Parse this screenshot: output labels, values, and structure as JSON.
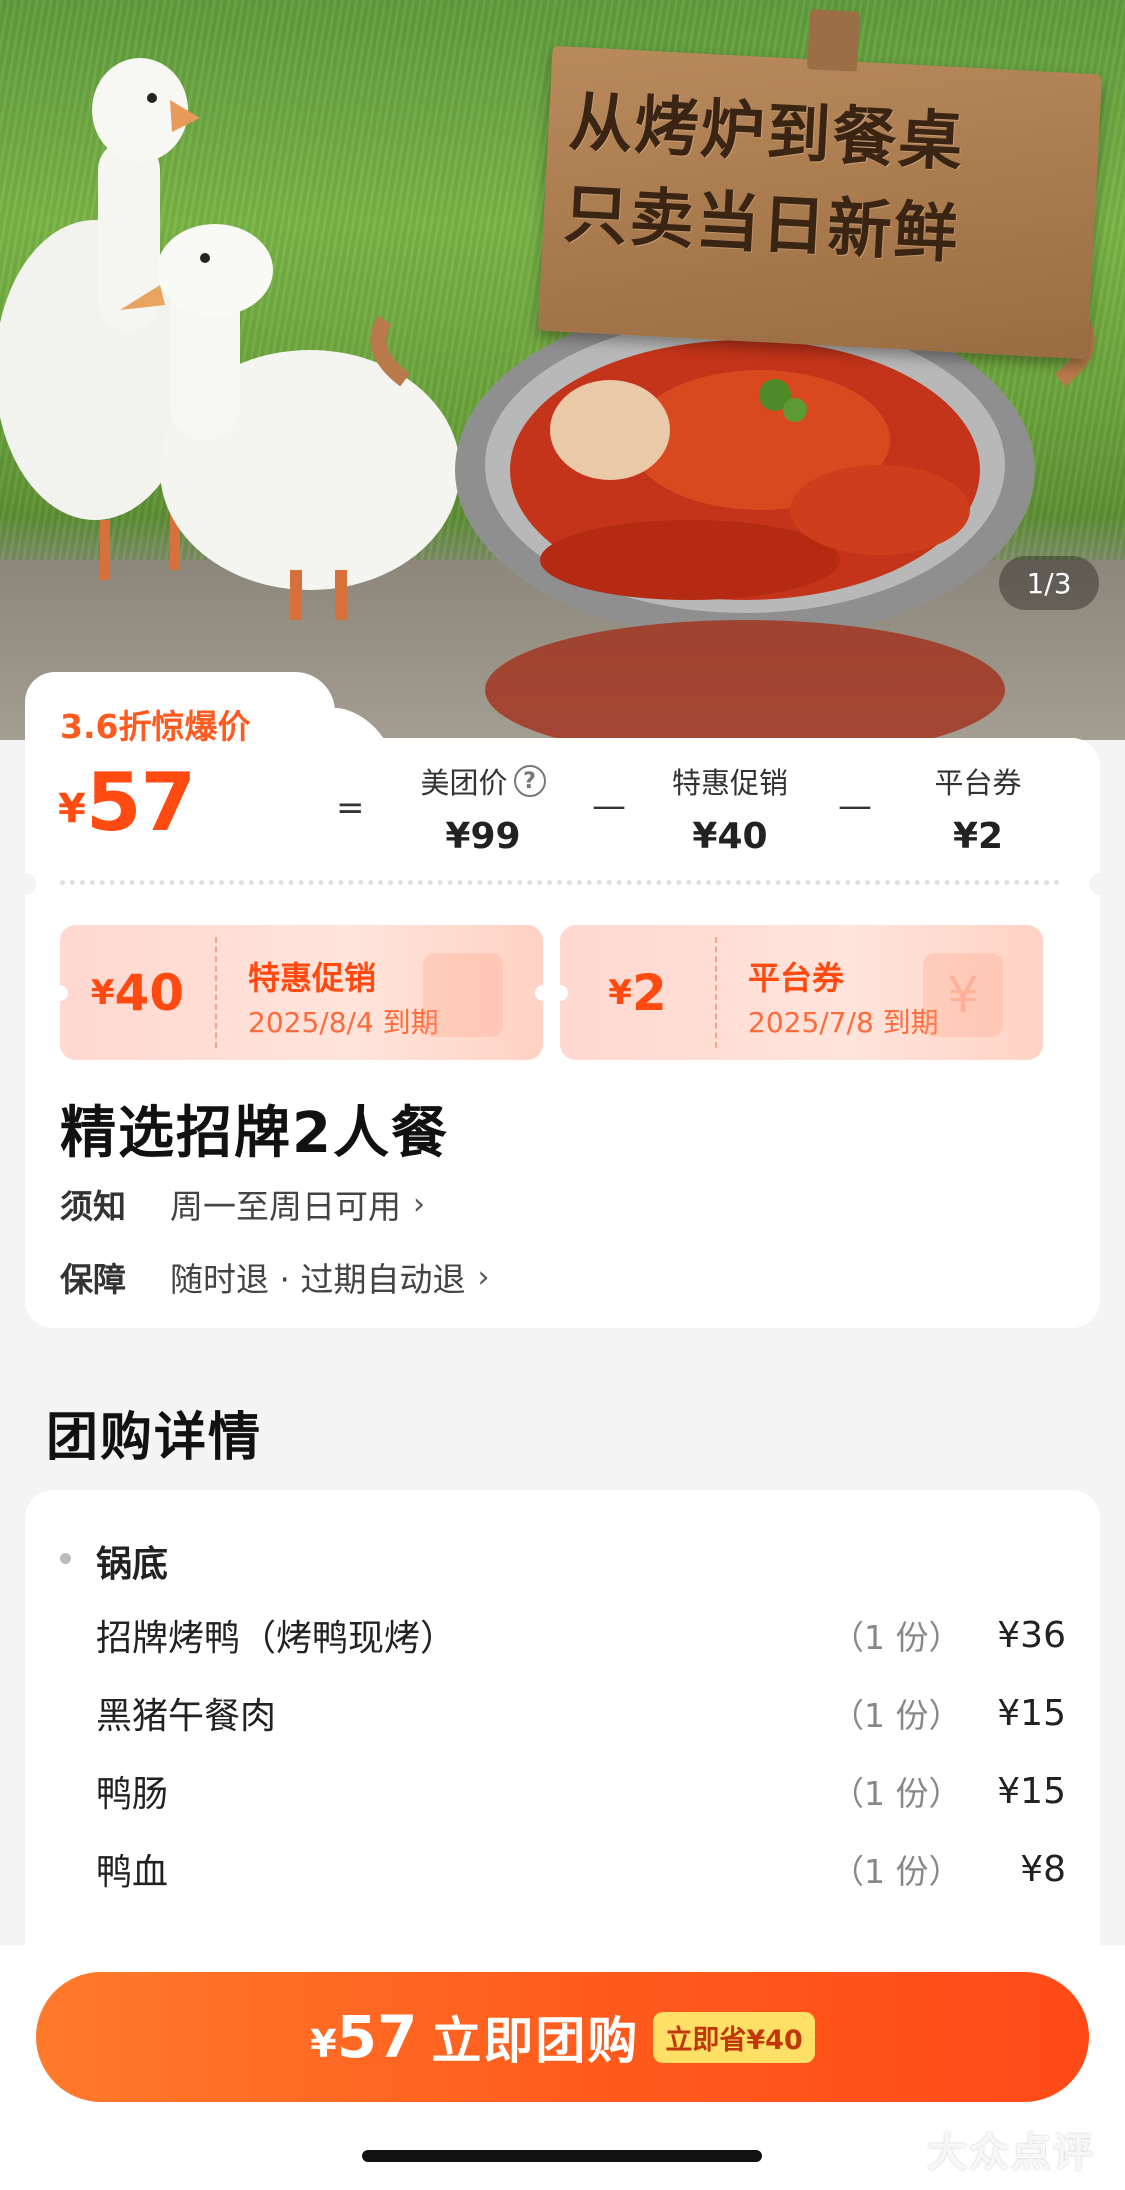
{
  "hero": {
    "sign_line_1": "从烤炉到餐桌",
    "sign_line_2": "只卖当日新鲜",
    "image_counter": "1/3"
  },
  "price": {
    "discount_label": "3.6折惊爆价",
    "currency": "¥",
    "final_price": "57",
    "equals": "=",
    "minus": "—",
    "meituan_label": "美团价",
    "meituan_value": "¥99",
    "promo_label": "特惠促销",
    "promo_value": "¥40",
    "platform_label": "平台券",
    "platform_value": "¥2"
  },
  "coupons": [
    {
      "amount": "40",
      "title": "特惠促销",
      "expiry": "2025/8/4 到期"
    },
    {
      "amount": "2",
      "title": "平台券",
      "expiry": "2025/7/8 到期"
    }
  ],
  "deal": {
    "title": "精选招牌2人餐",
    "notice_key": "须知",
    "notice_value": "周一至周日可用",
    "guarantee_key": "保障",
    "guarantee_value": "随时退 · 过期自动退"
  },
  "details": {
    "section_title": "团购详情",
    "group_title": "锅底",
    "items": [
      {
        "name": "招牌烤鸭（烤鸭现烤）",
        "qty": "（1 份）",
        "price": "¥36"
      },
      {
        "name": "黑猪午餐肉",
        "qty": "（1 份）",
        "price": "¥15"
      },
      {
        "name": "鸭肠",
        "qty": "（1 份）",
        "price": "¥15"
      },
      {
        "name": "鸭血",
        "qty": "（1 份）",
        "price": "¥8"
      }
    ]
  },
  "buy": {
    "currency": "¥",
    "price": "57",
    "label": "立即团购",
    "save_badge": "立即省¥40"
  },
  "watermark": "大众点评",
  "colors": {
    "accent": "#ff4b12",
    "coupon_bg": "#ffe0d6",
    "badge": "#ffe066"
  }
}
